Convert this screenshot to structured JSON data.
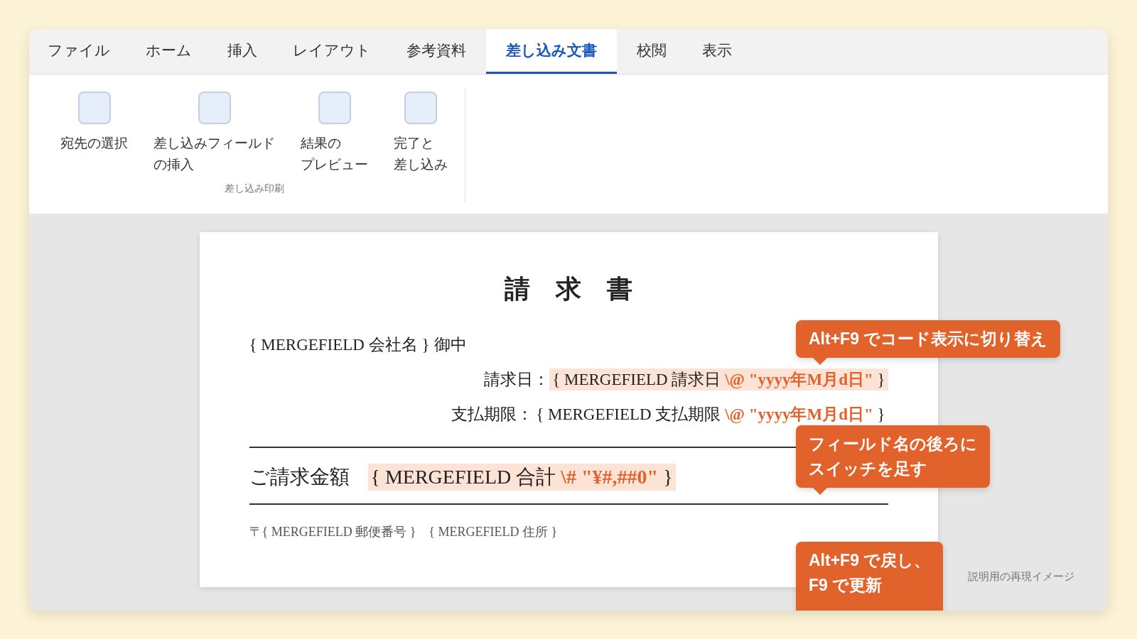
{
  "tabs": [
    {
      "label": "ファイル",
      "selected": false
    },
    {
      "label": "ホーム",
      "selected": false
    },
    {
      "label": "挿入",
      "selected": false
    },
    {
      "label": "レイアウト",
      "selected": false
    },
    {
      "label": "参考資料",
      "selected": false
    },
    {
      "label": "差し込み文書",
      "selected": true
    },
    {
      "label": "校閲",
      "selected": false
    },
    {
      "label": "表示",
      "selected": false
    }
  ],
  "ribbon": {
    "buttons": [
      {
        "lines": [
          "宛先の選択"
        ]
      },
      {
        "lines": [
          "差し込みフィールド",
          "の挿入"
        ]
      },
      {
        "lines": [
          "結果の",
          "プレビュー"
        ]
      },
      {
        "lines": [
          "完了と",
          "差し込み"
        ]
      }
    ],
    "group_label": "差し込み印刷"
  },
  "document": {
    "title": "請　求　書",
    "addressee": {
      "field": "{ MERGEFIELD 会社名 }",
      "suffix": "御中"
    },
    "date_rows": [
      {
        "label": "請求日：",
        "field": "{ MERGEFIELD 請求日 **\\@ \"yyyy年M月d日\"** }",
        "highlighted": true
      },
      {
        "label": "支払期限：",
        "field": "{ MERGEFIELD 支払期限 **\\@ \"yyyy年M月d日\"** }",
        "highlighted": false
      }
    ],
    "amount": {
      "label": "ご請求金額",
      "field": "{ MERGEFIELD 合計 **\\# \"¥#,##0\"** }",
      "highlighted": true
    },
    "address": "〒{ MERGEFIELD 郵便番号 }　{ MERGEFIELD 住所 }"
  },
  "callouts": [
    {
      "lines": [
        "Alt+F9 でコード表示に切り替え"
      ],
      "pointer": true
    },
    {
      "lines": [
        "フィールド名の後ろに",
        "スイッチを足す"
      ],
      "pointer": true
    },
    {
      "lines": [
        "Alt+F9 で戻し、",
        "F9 で更新"
      ]
    }
  ],
  "note": "説明用の再現イメージ"
}
